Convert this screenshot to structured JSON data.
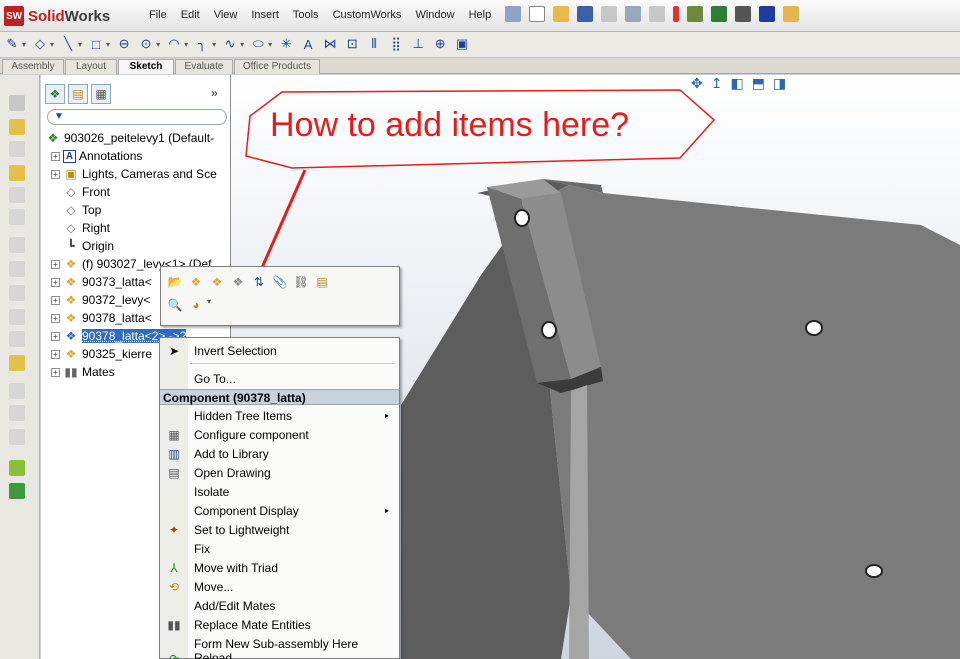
{
  "app": {
    "logo_prefix": "Solid",
    "logo_suffix": "Works",
    "logo_icon": "SW"
  },
  "menu": [
    "File",
    "Edit",
    "View",
    "Insert",
    "Tools",
    "CustomWorks",
    "Window",
    "Help"
  ],
  "command_tabs": [
    "Assembly",
    "Layout",
    "Sketch",
    "Evaluate",
    "Office Products"
  ],
  "active_tab": "Sketch",
  "panel": {
    "more": "»",
    "filter_icon": "▼"
  },
  "tree": [
    {
      "label": "903026_peitelevy1  (Default-",
      "icon": "assembly-icon"
    },
    {
      "label": "Annotations",
      "icon": "annotations-icon"
    },
    {
      "label": "Lights, Cameras and Sce",
      "icon": "lights-icon"
    },
    {
      "label": "Front",
      "icon": "plane-icon"
    },
    {
      "label": "Top",
      "icon": "plane-icon"
    },
    {
      "label": "Right",
      "icon": "plane-icon"
    },
    {
      "label": "Origin",
      "icon": "origin-icon"
    },
    {
      "label": "(f) 903027_levy<1> (Def",
      "icon": "part-icon"
    },
    {
      "label": "90373_latta<",
      "icon": "part-icon"
    },
    {
      "label": "90372_levy<",
      "icon": "part-icon"
    },
    {
      "label": "90378_latta<",
      "icon": "part-icon"
    },
    {
      "label": "90378_latta<2> ->?",
      "icon": "part-icon"
    },
    {
      "label": "90325_kierre",
      "icon": "part-icon"
    },
    {
      "label": "Mates",
      "icon": "mates-icon"
    }
  ],
  "callout": "How to add items here?",
  "context_menu": {
    "invert": "Invert Selection",
    "goto": "Go To...",
    "header": "Component (90378_latta)",
    "items": [
      {
        "label": "Hidden Tree Items",
        "submenu": "▸"
      },
      {
        "label": "Configure component"
      },
      {
        "label": "Add to Library"
      },
      {
        "label": "Open Drawing"
      },
      {
        "label": "Isolate"
      },
      {
        "label": "Component Display",
        "submenu": "▸"
      },
      {
        "label": "Set to Lightweight"
      },
      {
        "label": "Fix"
      },
      {
        "label": "Move with Triad"
      },
      {
        "label": "Move..."
      },
      {
        "label": "Add/Edit Mates"
      },
      {
        "label": "Replace Mate Entities"
      },
      {
        "label": "Form New Sub-assembly Here"
      },
      {
        "label": "Reload"
      }
    ]
  },
  "colors": {
    "callout": "#e51d1d",
    "selection": "#3169c6",
    "part": "#d7a93b",
    "accent": "#1d3f9a"
  }
}
